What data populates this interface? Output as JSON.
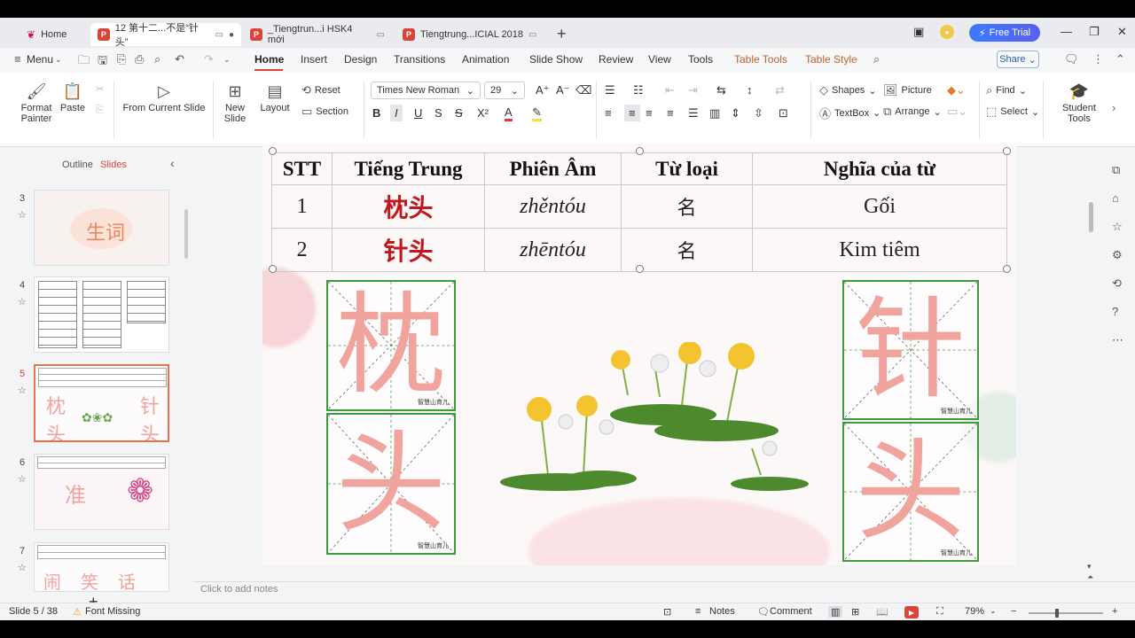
{
  "tabs": [
    {
      "label": "Home"
    },
    {
      "label": "12 第十二...不是“针头”"
    },
    {
      "label": "_Tiengtrun...i HSK4 mới"
    },
    {
      "label": "Tiengtrung...ICIAL 2018"
    }
  ],
  "titlebar": {
    "free_trial": "Free Trial"
  },
  "menu": {
    "menu_label": "Menu",
    "items": [
      "Home",
      "Insert",
      "Design",
      "Transitions",
      "Animation",
      "Slide Show",
      "Review",
      "View",
      "Tools",
      "Table Tools",
      "Table Style"
    ],
    "share": "Share"
  },
  "ribbon": {
    "format_painter": "Format Painter",
    "paste": "Paste",
    "from_current_slide": "From Current Slide",
    "new_slide": "New Slide",
    "layout": "Layout",
    "reset": "Reset",
    "section": "Section",
    "font_name": "Times New Roman",
    "font_size": "29",
    "shapes": "Shapes",
    "picture": "Picture",
    "textbox": "TextBox",
    "arrange": "Arrange",
    "find": "Find",
    "select": "Select",
    "student_tools": "Student Tools"
  },
  "panel": {
    "outline_tab": "Outline",
    "slides_tab": "Slides",
    "thumbs": [
      {
        "num": "3",
        "title": "生词"
      },
      {
        "num": "4"
      },
      {
        "num": "5"
      },
      {
        "num": "6"
      },
      {
        "num": "7"
      }
    ]
  },
  "slide": {
    "table": {
      "headers": [
        "STT",
        "Tiếng Trung",
        "Phiên Âm",
        "Từ loại",
        "Nghĩa của từ"
      ],
      "rows": [
        [
          "1",
          "枕头",
          "zhěntóu",
          "名",
          "Gối"
        ],
        [
          "2",
          "针头",
          "zhēntóu",
          "名",
          "Kim tiêm"
        ]
      ]
    },
    "hw_left": [
      "枕",
      "头"
    ],
    "hw_right": [
      "针",
      "头"
    ],
    "watermark": "智慧山育儿"
  },
  "notes_placeholder": "Click to add notes",
  "status": {
    "slide_info": "Slide 5 / 38",
    "font_missing": "Font Missing",
    "notes": "Notes",
    "comment": "Comment",
    "zoom": "79%"
  }
}
